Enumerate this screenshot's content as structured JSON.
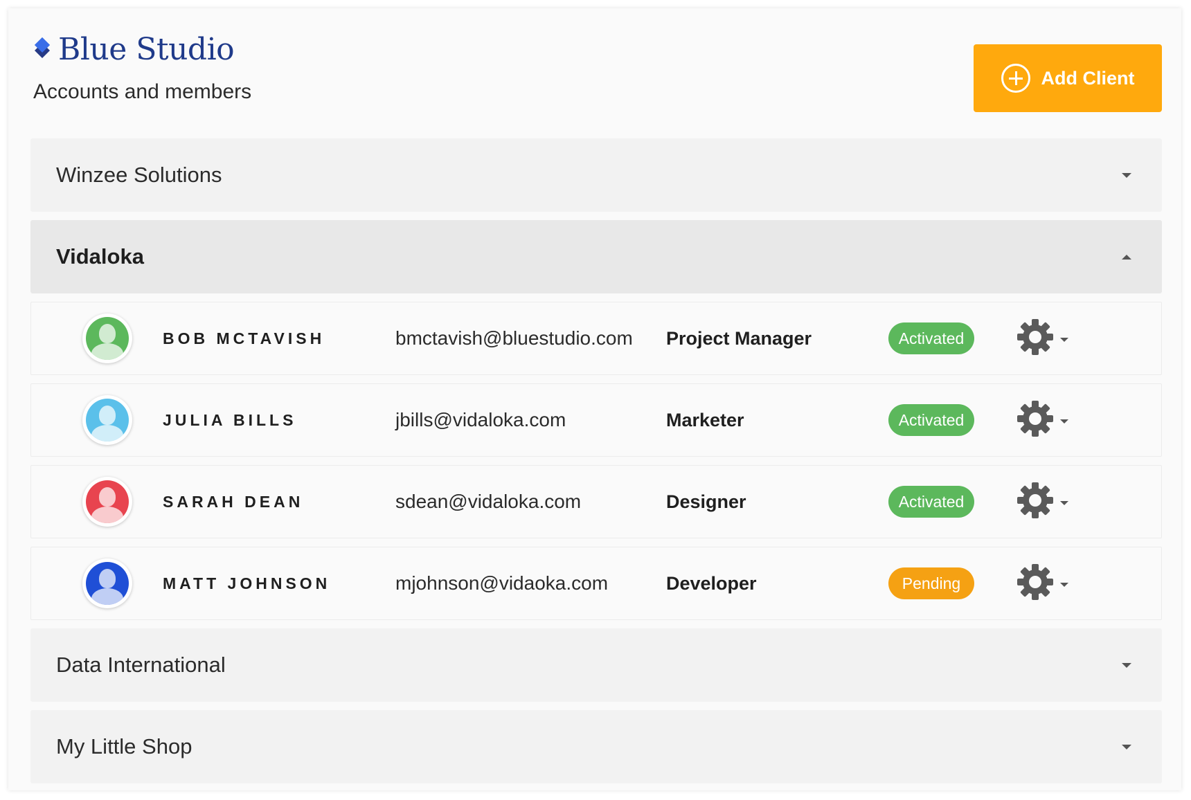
{
  "header": {
    "brand_name": "Blue Studio",
    "subtitle": "Accounts and members",
    "add_client_label": "Add Client",
    "logo_icon": "diamond-stack-icon",
    "accent_color": "#ffa90d",
    "brand_color": "#1f3a8a"
  },
  "groups": [
    {
      "title": "Winzee Solutions",
      "open": false
    },
    {
      "title": "Vidaloka",
      "open": true
    },
    {
      "title": "Data International",
      "open": false
    },
    {
      "title": "My Little Shop",
      "open": false
    }
  ],
  "members": [
    {
      "name": "BOB MCTAVISH",
      "email": "bmctavish@bluestudio.com",
      "role": "Project Manager",
      "status": "Activated",
      "status_color": "#5cb85c",
      "avatar_color": "#5cb85c"
    },
    {
      "name": "JULIA BILLS",
      "email": "jbills@vidaloka.com",
      "role": "Marketer",
      "status": "Activated",
      "status_color": "#5cb85c",
      "avatar_color": "#5bc0ea"
    },
    {
      "name": "SARAH DEAN",
      "email": "sdean@vidaloka.com",
      "role": "Designer",
      "status": "Activated",
      "status_color": "#5cb85c",
      "avatar_color": "#e8444f"
    },
    {
      "name": "MATT JOHNSON",
      "email": "mjohnson@vidaoka.com",
      "role": "Developer",
      "status": "Pending",
      "status_color": "#f5a113",
      "avatar_color": "#1f4fd6"
    }
  ]
}
